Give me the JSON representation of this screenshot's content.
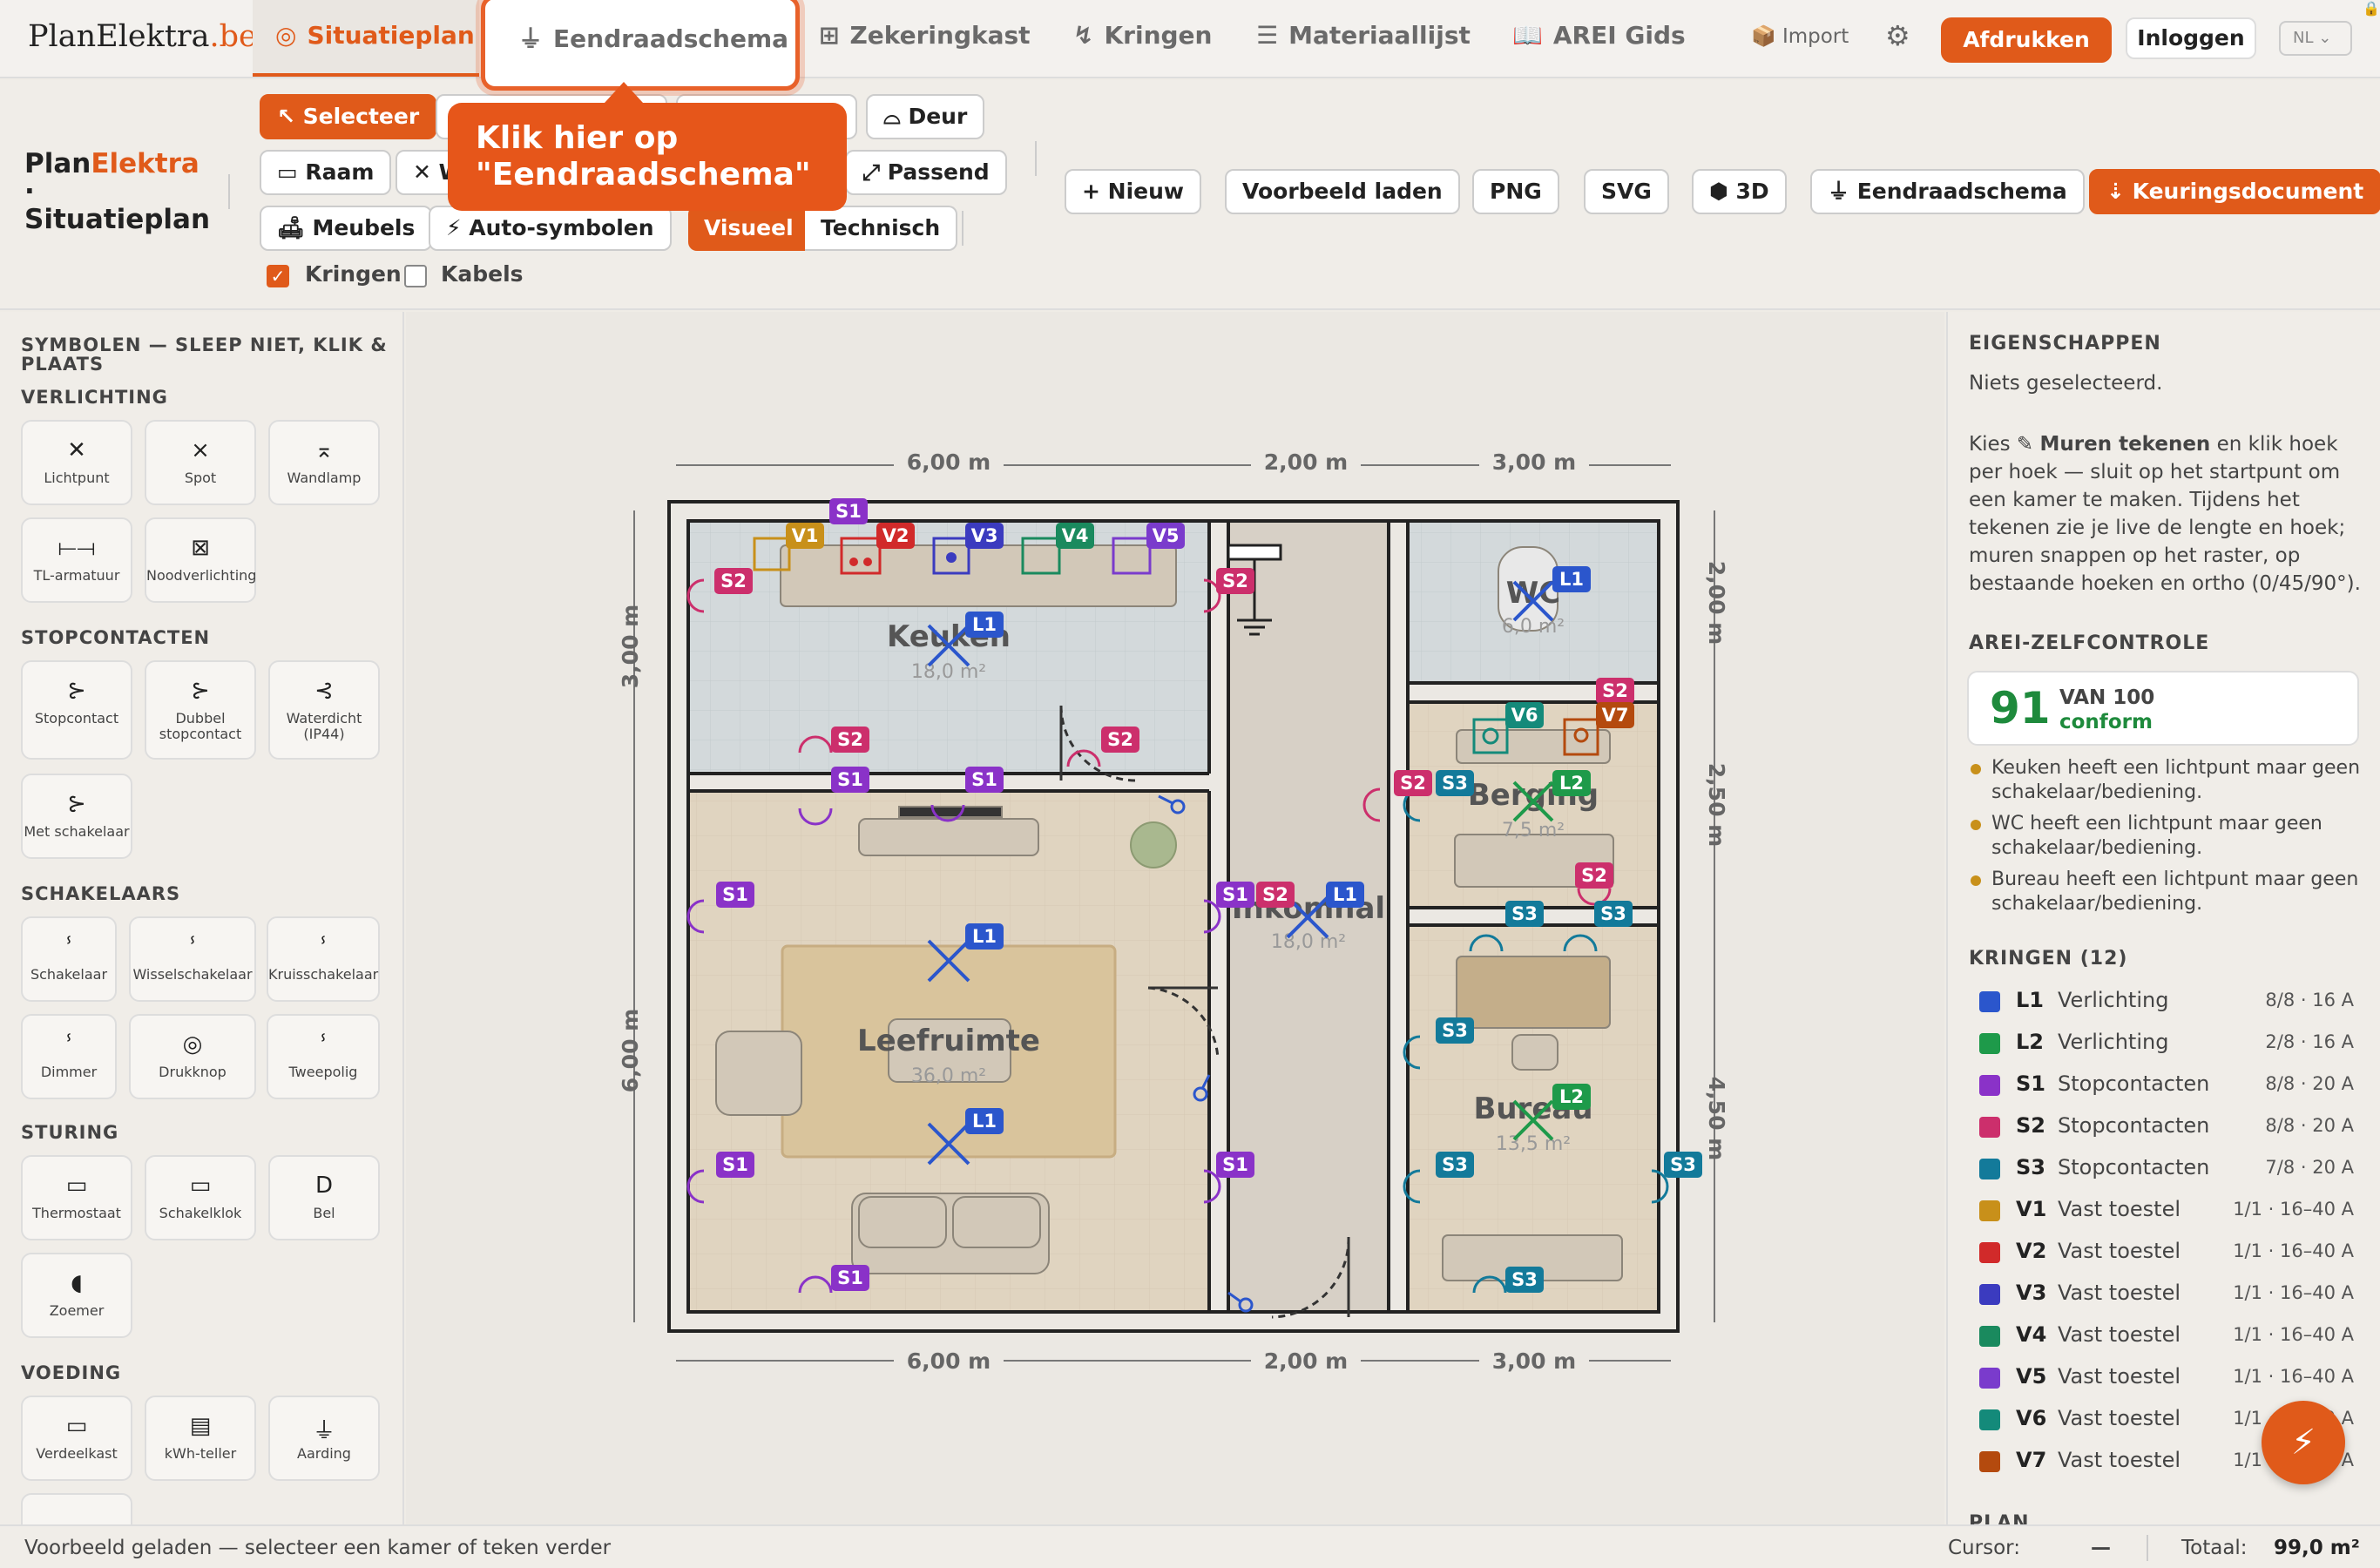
{
  "app": {
    "logo_main": "PlanElektra",
    "logo_suffix": ".be"
  },
  "tabs": [
    {
      "label": "Situatieplan",
      "icon": "◎"
    },
    {
      "label": "Eendraadschema",
      "icon": "⏚"
    },
    {
      "label": "Zekeringkast",
      "icon": "⊞"
    },
    {
      "label": "Kringen",
      "icon": "↯"
    },
    {
      "label": "Materiaallijst",
      "icon": "☰"
    },
    {
      "label": "AREI Gids",
      "icon": "📖"
    }
  ],
  "header": {
    "import": "📦 Import",
    "gear": "⚙",
    "print": "Afdrukken",
    "login": "Inloggen",
    "lang": "NL ⌄"
  },
  "brand": {
    "line1a": "Plan",
    "line1b": "Elektra",
    "dot": "·",
    "line2": "Situatieplan"
  },
  "toolbar": {
    "select": "↖ Selecteer",
    "door": "⌓ Deur",
    "window": "▭ Raam",
    "window2": "✕ W",
    "fit": "⤢ Passend",
    "furniture": "🛋 Meubels",
    "auto_symbols": "⚡ Auto-symbolen",
    "visual": "Visueel",
    "technical": "Technisch",
    "new": "+ Nieuw",
    "load_example": "Voorbeeld laden",
    "png": "PNG",
    "svg": "SVG",
    "three_d": "⬢ 3D",
    "single_line": "⏚ Eendraadschema",
    "inspection_doc": "⇣ Keuringsdocument",
    "kringen_label": "Kringen",
    "kringen_checked": true,
    "kabels_label": "Kabels",
    "kabels_checked": false
  },
  "tooltip": {
    "line1": "Klik hier op",
    "line2": "\"Eendraadschema\""
  },
  "symbols": {
    "title1": "SYMBOLEN — SLEEP NIET, KLIK &",
    "title2": "PLAATS",
    "sections": [
      {
        "title": "VERLICHTING",
        "items": [
          {
            "label": "Lichtpunt",
            "icon": "✕"
          },
          {
            "label": "Spot",
            "icon": "×"
          },
          {
            "label": "Wandlamp",
            "icon": "⌅"
          },
          {
            "label": "TL-armatuur",
            "icon": "⟝⟞"
          },
          {
            "label": "Noodverlichting",
            "icon": "⊠"
          }
        ]
      },
      {
        "title": "STOPCONTACTEN",
        "items": [
          {
            "label": "Stopcontact",
            "icon": "⊱"
          },
          {
            "label": "Dubbel stopcontact",
            "icon": "⊱"
          },
          {
            "label": "Waterdicht (IP44)",
            "icon": "⊰"
          },
          {
            "label": "Met schakelaar",
            "icon": "⊱"
          }
        ]
      },
      {
        "title": "SCHAKELAARS",
        "items": [
          {
            "label": "Schakelaar",
            "icon": "ⸯ"
          },
          {
            "label": "Wisselschakelaar",
            "icon": "ⸯ"
          },
          {
            "label": "Kruisschakelaar",
            "icon": "ⸯ"
          },
          {
            "label": "Dimmer",
            "icon": "ⸯ"
          },
          {
            "label": "Drukknop",
            "icon": "◎"
          },
          {
            "label": "Tweepolig",
            "icon": "ⸯ"
          }
        ]
      },
      {
        "title": "STURING",
        "items": [
          {
            "label": "Thermostaat",
            "icon": "▭"
          },
          {
            "label": "Schakelklok",
            "icon": "▭"
          },
          {
            "label": "Bel",
            "icon": "D"
          },
          {
            "label": "Zoemer",
            "icon": "◖"
          }
        ]
      },
      {
        "title": "VOEDING",
        "items": [
          {
            "label": "Verdeelkast",
            "icon": "▭"
          },
          {
            "label": "kWh-teller",
            "icon": "▤"
          },
          {
            "label": "Aarding",
            "icon": "⏚"
          }
        ]
      }
    ]
  },
  "plan": {
    "dims": {
      "top": [
        "6,00 m",
        "2,00 m",
        "3,00 m"
      ],
      "bottom": [
        "6,00 m",
        "2,00 m",
        "3,00 m"
      ],
      "left": [
        "3,00 m",
        "6,00 m"
      ],
      "right": [
        "2,00 m",
        "2,50 m",
        "4,50 m"
      ]
    },
    "rooms": [
      {
        "name": "Keuken",
        "area": "18,0 m²"
      },
      {
        "name": "WC",
        "area": "6,0 m²"
      },
      {
        "name": "Berging",
        "area": "7,5 m²"
      },
      {
        "name": "Inkomhal",
        "area": "18,0 m²"
      },
      {
        "name": "Leefruimte",
        "area": "36,0 m²"
      },
      {
        "name": "Bureau",
        "area": "13,5 m²"
      }
    ],
    "badges": {
      "L1": "L1",
      "L2": "L2",
      "S1": "S1",
      "S2": "S2",
      "S3": "S3",
      "V1": "V1",
      "V2": "V2",
      "V3": "V3",
      "V4": "V4",
      "V5": "V5",
      "V6": "V6",
      "V7": "V7"
    },
    "colors": {
      "L1": "#2b56cc",
      "L2": "#1e9a4a",
      "S1": "#8a32c8",
      "S2": "#cc2f6c",
      "S3": "#137a9a",
      "V1": "#c8901a",
      "V2": "#d12a2a",
      "V3": "#3b3bbf",
      "V4": "#1a8a5e",
      "V5": "#7a3bcc",
      "V6": "#148a7a",
      "V7": "#b44a0e"
    }
  },
  "properties": {
    "title": "EIGENSCHAPPEN",
    "none": "Niets geselecteerd.",
    "help_pre": "Kies ✎ ",
    "help_bold": "Muren tekenen",
    "help_post": " en klik hoek per hoek — sluit op het startpunt om een kamer te maken. Tijdens het tekenen zie je live de lengte en hoek; muren snappen op het raster, op bestaande hoeken en ortho (0/45/90°)."
  },
  "arei": {
    "title": "AREI-ZELFCONTROLE",
    "score": "91",
    "of": "VAN 100",
    "status": "conform",
    "warnings": [
      "Keuken heeft een lichtpunt maar geen schakelaar/bediening.",
      "WC heeft een lichtpunt maar geen schakelaar/bediening.",
      "Bureau heeft een lichtpunt maar geen schakelaar/bediening."
    ]
  },
  "kringen": {
    "title": "KRINGEN (12)",
    "items": [
      {
        "id": "L1",
        "name": "Verlichting",
        "info": "8/8 · 16 A",
        "color": "#2b56cc"
      },
      {
        "id": "L2",
        "name": "Verlichting",
        "info": "2/8 · 16 A",
        "color": "#1e9a4a"
      },
      {
        "id": "S1",
        "name": "Stopcontacten",
        "info": "8/8 · 20 A",
        "color": "#8a32c8"
      },
      {
        "id": "S2",
        "name": "Stopcontacten",
        "info": "8/8 · 20 A",
        "color": "#cc2f6c"
      },
      {
        "id": "S3",
        "name": "Stopcontacten",
        "info": "7/8 · 20 A",
        "color": "#137a9a"
      },
      {
        "id": "V1",
        "name": "Vast toestel",
        "info": "1/1 · 16–40 A",
        "color": "#c8901a"
      },
      {
        "id": "V2",
        "name": "Vast toestel",
        "info": "1/1 · 16–40 A",
        "color": "#d12a2a"
      },
      {
        "id": "V3",
        "name": "Vast toestel",
        "info": "1/1 · 16–40 A",
        "color": "#3b3bbf"
      },
      {
        "id": "V4",
        "name": "Vast toestel",
        "info": "1/1 · 16–40 A",
        "color": "#1a8a5e"
      },
      {
        "id": "V5",
        "name": "Vast toestel",
        "info": "1/1 · 16–40 A",
        "color": "#7a3bcc"
      },
      {
        "id": "V6",
        "name": "Vast toestel",
        "info": "1/1 · 16–40 A",
        "color": "#148a7a"
      },
      {
        "id": "V7",
        "name": "Vast toestel",
        "info": "1/1 · 16–40 A",
        "color": "#b44a0e"
      }
    ],
    "next_title": "PLAN"
  },
  "fab": {
    "icon": "⚡"
  },
  "status": {
    "message": "Voorbeeld geladen — selecteer een kamer of teken verder",
    "cursor_label": "Cursor:",
    "cursor_value": "—",
    "total_label": "Totaal:",
    "total_value": "99,0 m²"
  }
}
